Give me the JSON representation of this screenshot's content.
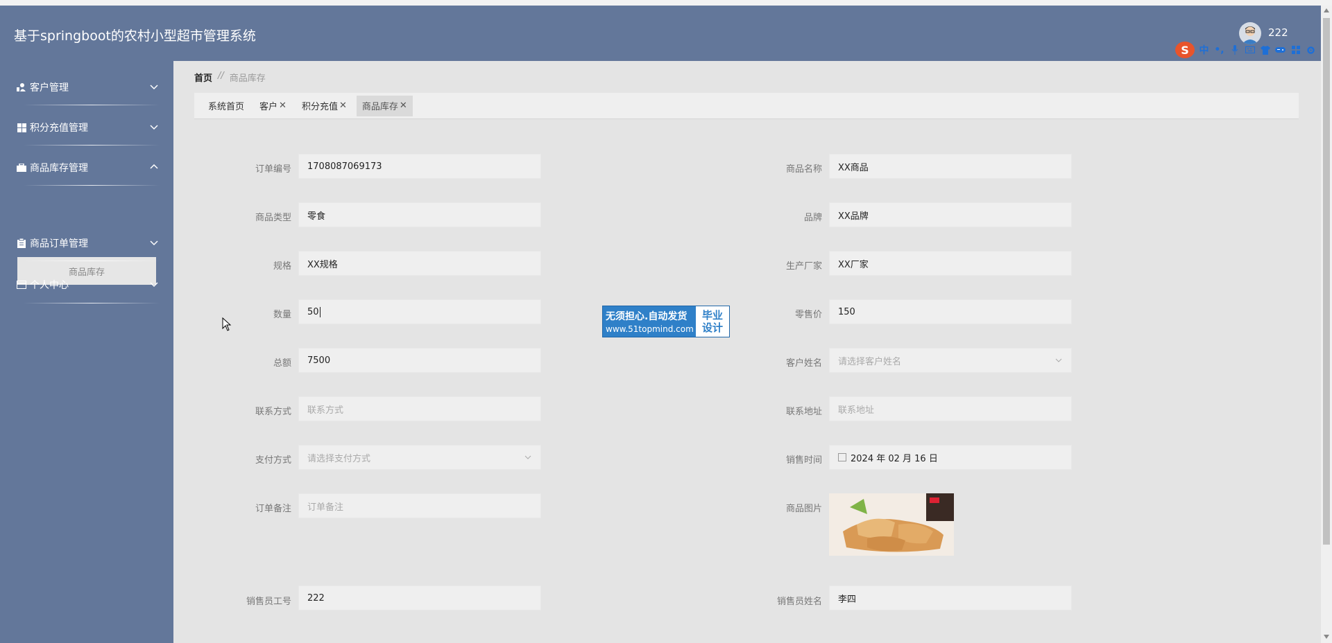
{
  "app": {
    "title": "基于springboot的农村小型超市管理系统",
    "username": "222"
  },
  "ime": {
    "logo": "S",
    "mode": "中"
  },
  "sidebar": {
    "items": [
      {
        "label": "客户管理",
        "icon": "user-icon"
      },
      {
        "label": "积分充值管理",
        "icon": "grid-icon"
      },
      {
        "label": "商品库存管理",
        "icon": "briefcase-icon",
        "expanded": true
      },
      {
        "label": "商品订单管理",
        "icon": "clipboard-icon"
      },
      {
        "label": "个人中心",
        "icon": "card-icon"
      }
    ],
    "submenu": {
      "label": "商品库存"
    }
  },
  "breadcrumb": {
    "home": "首页",
    "sep": "//",
    "current": "商品库存"
  },
  "tabs": [
    {
      "label": "系统首页"
    },
    {
      "label": "客户"
    },
    {
      "label": "积分充值"
    },
    {
      "label": "商品库存"
    }
  ],
  "form": {
    "order_no": {
      "label": "订单编号",
      "value": "1708087069173"
    },
    "product_name": {
      "label": "商品名称",
      "value": "XX商品"
    },
    "product_type": {
      "label": "商品类型",
      "value": "零食"
    },
    "brand": {
      "label": "品牌",
      "value": "XX品牌"
    },
    "spec": {
      "label": "规格",
      "value": "XX规格"
    },
    "manufacturer": {
      "label": "生产厂家",
      "value": "XX厂家"
    },
    "quantity": {
      "label": "数量",
      "value": "50"
    },
    "retail_price": {
      "label": "零售价",
      "value": "150"
    },
    "total": {
      "label": "总额",
      "value": "7500"
    },
    "customer_name": {
      "label": "客户姓名",
      "placeholder": "请选择客户姓名"
    },
    "contact": {
      "label": "联系方式",
      "placeholder": "联系方式"
    },
    "address": {
      "label": "联系地址",
      "placeholder": "联系地址"
    },
    "payment": {
      "label": "支付方式",
      "placeholder": "请选择支付方式"
    },
    "sale_time": {
      "label": "销售时间",
      "value": "2024 年 02 月 16 日"
    },
    "remark": {
      "label": "订单备注",
      "placeholder": "订单备注"
    },
    "product_image": {
      "label": "商品图片"
    },
    "seller_id": {
      "label": "销售员工号",
      "value": "222"
    },
    "seller_name": {
      "label": "销售员姓名",
      "value": "李四"
    }
  },
  "watermark": {
    "line1": "无须担心.自动发货",
    "line2": "www.51topmind.com",
    "tag1": "毕业",
    "tag2": "设计"
  },
  "colors": {
    "sidebar": "#63779a",
    "header": "#63779a",
    "background": "#e4e4e4",
    "watermark": "#2f80c8"
  }
}
